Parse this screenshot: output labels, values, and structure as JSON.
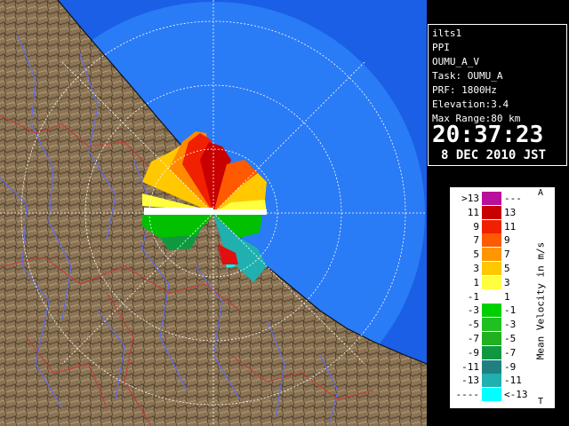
{
  "info": {
    "station": "ilts1",
    "mode": "PPI",
    "product": "OUMU_A_V",
    "task": "Task: OUMU_A",
    "prf": "PRF: 1800Hz",
    "elevation": "Elevation:3.4",
    "max_range": "Max Range:80 km",
    "time": "20:37:23",
    "date": "8 DEC 2010 JST"
  },
  "scale": {
    "title": "Mean Velocity in m/s",
    "corner_top": "A",
    "corner_bottom": "T",
    "bins": [
      {
        "low": ">13",
        "high": "---",
        "color": "#b8109a"
      },
      {
        "low": "11",
        "high": "13",
        "color": "#c80000"
      },
      {
        "low": "9",
        "high": "11",
        "color": "#f02000"
      },
      {
        "low": "7",
        "high": "9",
        "color": "#ff5a00"
      },
      {
        "low": "5",
        "high": "7",
        "color": "#ff9600"
      },
      {
        "low": "3",
        "high": "5",
        "color": "#ffc800"
      },
      {
        "low": "1",
        "high": "3",
        "color": "#ffff40"
      },
      {
        "low": "-1",
        "high": "1",
        "color": "#ffffff"
      },
      {
        "low": "-3",
        "high": "-1",
        "color": "#00d000"
      },
      {
        "low": "-5",
        "high": "-3",
        "color": "#20c020"
      },
      {
        "low": "-7",
        "high": "-5",
        "color": "#20b020"
      },
      {
        "low": "-9",
        "high": "-7",
        "color": "#109840"
      },
      {
        "low": "-11",
        "high": "-9",
        "color": "#208080"
      },
      {
        "low": "-13",
        "high": "-11",
        "color": "#20b0b0"
      },
      {
        "low": "----",
        "high": "<-13",
        "color": "#00ffff"
      }
    ]
  },
  "colors": {
    "ocean": "#1a66ff",
    "ocean_inner": "#2a7bf6",
    "land": "#8a7455",
    "river": "#5060ff",
    "border": "#c03030",
    "ring": "#ffffff"
  }
}
